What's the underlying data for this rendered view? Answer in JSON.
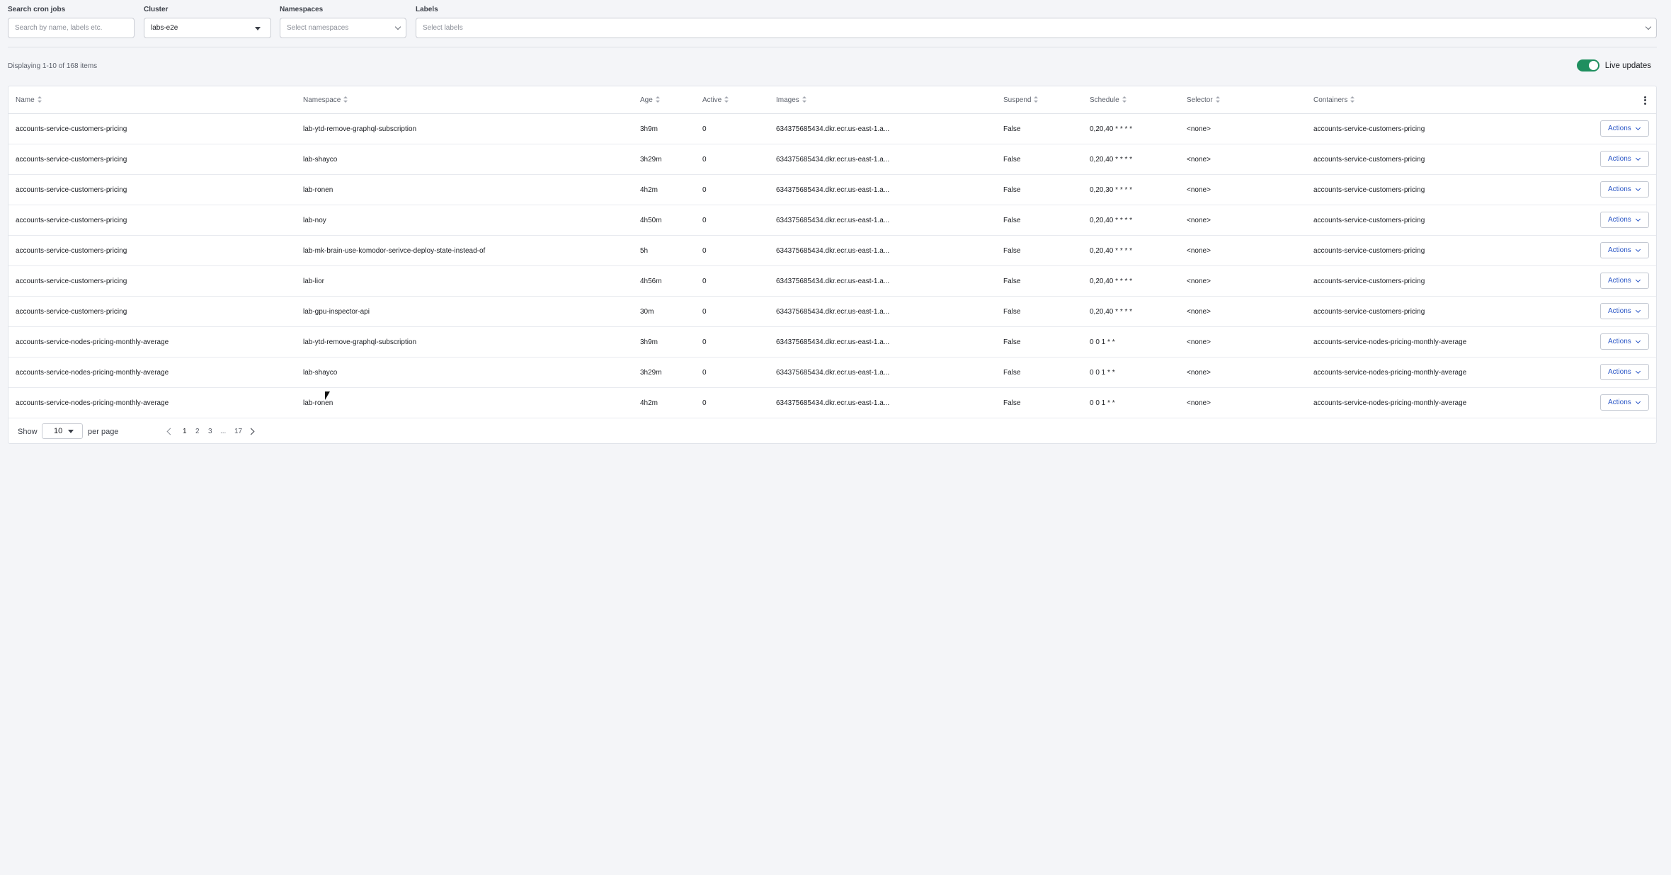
{
  "filters": {
    "search": {
      "label": "Search cron jobs",
      "placeholder": "Search by name, labels etc."
    },
    "cluster": {
      "label": "Cluster",
      "value": "labs-e2e"
    },
    "namespaces": {
      "label": "Namespaces",
      "placeholder": "Select namespaces"
    },
    "labels": {
      "label": "Labels",
      "placeholder": "Select labels"
    }
  },
  "summary": "Displaying 1-10 of 168 items",
  "live_updates": {
    "label": "Live updates",
    "enabled": true,
    "color": "#1f8f5f"
  },
  "columns": [
    "Name",
    "Namespace",
    "Age",
    "Active",
    "Images",
    "Suspend",
    "Schedule",
    "Selector",
    "Containers"
  ],
  "rows": [
    {
      "name": "accounts-service-customers-pricing",
      "namespace": "lab-ytd-remove-graphql-subscription",
      "age": "3h9m",
      "active": "0",
      "images": "634375685434.dkr.ecr.us-east-1.a...",
      "suspend": "False",
      "schedule": "0,20,40 * * * *",
      "selector": "<none>",
      "containers": "accounts-service-customers-pricing",
      "action": "Actions"
    },
    {
      "name": "accounts-service-customers-pricing",
      "namespace": "lab-shayco",
      "age": "3h29m",
      "active": "0",
      "images": "634375685434.dkr.ecr.us-east-1.a...",
      "suspend": "False",
      "schedule": "0,20,40 * * * *",
      "selector": "<none>",
      "containers": "accounts-service-customers-pricing",
      "action": "Actions"
    },
    {
      "name": "accounts-service-customers-pricing",
      "namespace": "lab-ronen",
      "age": "4h2m",
      "active": "0",
      "images": "634375685434.dkr.ecr.us-east-1.a...",
      "suspend": "False",
      "schedule": "0,20,30 * * * *",
      "selector": "<none>",
      "containers": "accounts-service-customers-pricing",
      "action": "Actions"
    },
    {
      "name": "accounts-service-customers-pricing",
      "namespace": "lab-noy",
      "age": "4h50m",
      "active": "0",
      "images": "634375685434.dkr.ecr.us-east-1.a...",
      "suspend": "False",
      "schedule": "0,20,40 * * * *",
      "selector": "<none>",
      "containers": "accounts-service-customers-pricing",
      "action": "Actions"
    },
    {
      "name": "accounts-service-customers-pricing",
      "namespace": "lab-mk-brain-use-komodor-serivce-deploy-state-instead-of",
      "age": "5h",
      "active": "0",
      "images": "634375685434.dkr.ecr.us-east-1.a...",
      "suspend": "False",
      "schedule": "0,20,40 * * * *",
      "selector": "<none>",
      "containers": "accounts-service-customers-pricing",
      "action": "Actions"
    },
    {
      "name": "accounts-service-customers-pricing",
      "namespace": "lab-lior",
      "age": "4h56m",
      "active": "0",
      "images": "634375685434.dkr.ecr.us-east-1.a...",
      "suspend": "False",
      "schedule": "0,20,40 * * * *",
      "selector": "<none>",
      "containers": "accounts-service-customers-pricing",
      "action": "Actions"
    },
    {
      "name": "accounts-service-customers-pricing",
      "namespace": "lab-gpu-inspector-api",
      "age": "30m",
      "active": "0",
      "images": "634375685434.dkr.ecr.us-east-1.a...",
      "suspend": "False",
      "schedule": "0,20,40 * * * *",
      "selector": "<none>",
      "containers": "accounts-service-customers-pricing",
      "action": "Actions"
    },
    {
      "name": "accounts-service-nodes-pricing-monthly-average",
      "namespace": "lab-ytd-remove-graphql-subscription",
      "age": "3h9m",
      "active": "0",
      "images": "634375685434.dkr.ecr.us-east-1.a...",
      "suspend": "False",
      "schedule": "0 0 1 * *",
      "selector": "<none>",
      "containers": "accounts-service-nodes-pricing-monthly-average",
      "action": "Actions"
    },
    {
      "name": "accounts-service-nodes-pricing-monthly-average",
      "namespace": "lab-shayco",
      "age": "3h29m",
      "active": "0",
      "images": "634375685434.dkr.ecr.us-east-1.a...",
      "suspend": "False",
      "schedule": "0 0 1 * *",
      "selector": "<none>",
      "containers": "accounts-service-nodes-pricing-monthly-average",
      "action": "Actions"
    },
    {
      "name": "accounts-service-nodes-pricing-monthly-average",
      "namespace": "lab-ronen",
      "age": "4h2m",
      "active": "0",
      "images": "634375685434.dkr.ecr.us-east-1.a...",
      "suspend": "False",
      "schedule": "0 0 1 * *",
      "selector": "<none>",
      "containers": "accounts-service-nodes-pricing-monthly-average",
      "action": "Actions"
    }
  ],
  "pagination": {
    "show_label": "Show",
    "per_page_value": "10",
    "per_page_label": "per page",
    "pages": [
      "1",
      "2",
      "3",
      "...",
      "17"
    ],
    "current": "1"
  }
}
